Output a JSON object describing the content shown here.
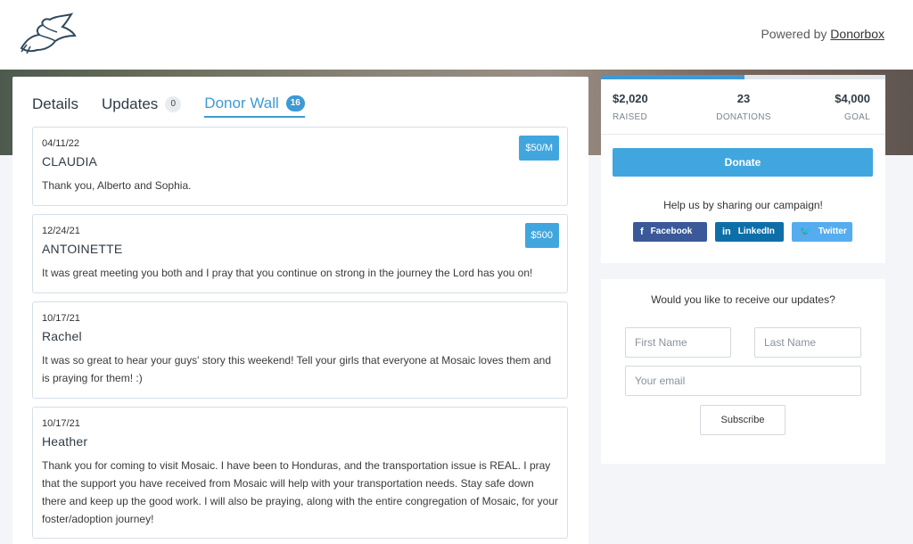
{
  "header": {
    "logo_icon": "dove-logo-icon",
    "powered_by": "Powered by",
    "powered_link": "Donorbox"
  },
  "tabs": [
    {
      "label": "Details",
      "count": null
    },
    {
      "label": "Updates",
      "count": "0"
    },
    {
      "label": "Donor Wall",
      "count": "16"
    }
  ],
  "donors": [
    {
      "date": "04/11/22",
      "name": "CLAUDIA",
      "amount": "$50/M",
      "message": "Thank you, Alberto and Sophia."
    },
    {
      "date": "12/24/21",
      "name": "ANTOINETTE",
      "amount": "$500",
      "message": "It was great meeting you both and I pray that you continue on strong in the journey the Lord has you on!"
    },
    {
      "date": "10/17/21",
      "name": "Rachel",
      "amount": "",
      "message": "It was so great to hear your guys' story this weekend! Tell your girls that everyone at Mosaic loves them and is praying for them! :)"
    },
    {
      "date": "10/17/21",
      "name": "Heather",
      "amount": "",
      "message": "Thank you for coming to visit Mosaic. I have been to Honduras, and the transportation issue is REAL. I pray that the support you have received from Mosaic will help with your transportation needs. Stay safe down there and keep up the good work. I will also be praying, along with the entire congregation of Mosaic, for your foster/adoption journey!"
    }
  ],
  "campaign": {
    "progress_percent": 50.5,
    "raised_value": "$2,020",
    "raised_label": "RAISED",
    "donations_value": "23",
    "donations_label": "DONATIONS",
    "goal_value": "$4,000",
    "goal_label": "GOAL",
    "donate_label": "Donate",
    "share_text": "Help us by sharing our campaign!",
    "share_buttons": [
      {
        "label": "Facebook",
        "icon": "f",
        "color": "#3b5998"
      },
      {
        "label": "LinkedIn",
        "icon": "in",
        "color": "#0e6fa8"
      },
      {
        "label": "Twitter",
        "icon": "🐦",
        "color": "#55acee"
      }
    ]
  },
  "subscribe": {
    "title": "Would you like to receive our updates?",
    "first_name_placeholder": "First Name",
    "last_name_placeholder": "Last Name",
    "email_placeholder": "Your email",
    "button_label": "Subscribe"
  },
  "colors": {
    "accent": "#42a6de",
    "text": "#2f3b45"
  }
}
